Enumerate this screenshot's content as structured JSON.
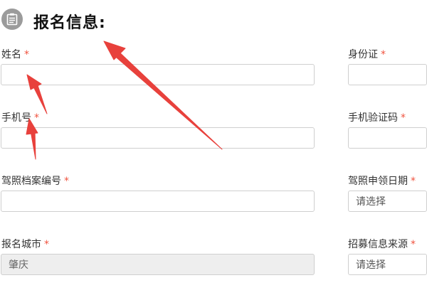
{
  "header": {
    "title": "报名信息:",
    "icon": "form-icon"
  },
  "required_mark": "*",
  "fields": {
    "name": {
      "label": "姓名",
      "value": ""
    },
    "id_card": {
      "label": "身份证",
      "value": ""
    },
    "phone": {
      "label": "手机号",
      "value": ""
    },
    "sms_code": {
      "label": "手机验证码",
      "value": ""
    },
    "license_file_no": {
      "label": "驾照档案编号",
      "value": ""
    },
    "license_date": {
      "label": "驾照申领日期",
      "value": "请选择"
    },
    "city": {
      "label": "报名城市",
      "value": "肇庆"
    },
    "recruit_source": {
      "label": "招募信息来源",
      "value": "请选择"
    }
  },
  "colors": {
    "required": "#f0533f",
    "arrow": "#e8413c",
    "icon_bg": "#9b9b9b"
  }
}
